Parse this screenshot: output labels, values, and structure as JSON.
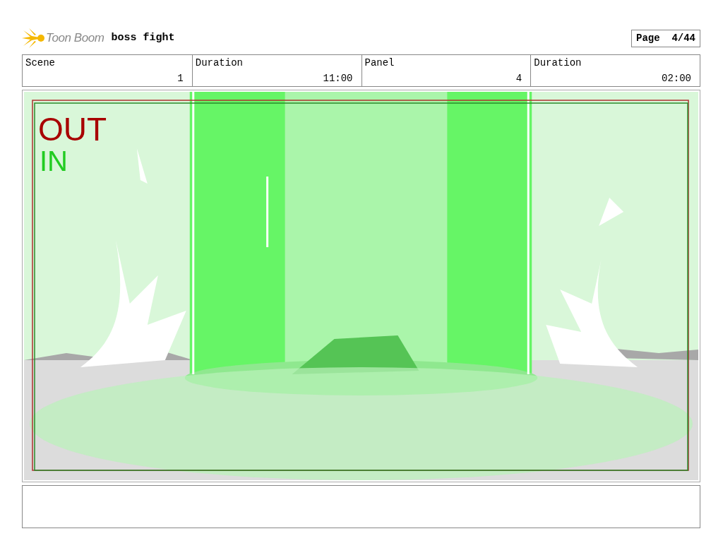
{
  "header": {
    "logo_text": "Toon Boom",
    "title": "boss fight",
    "page": "Page  4/44"
  },
  "info": [
    {
      "label": "Scene",
      "value": "1"
    },
    {
      "label": "Duration",
      "value": "11:00"
    },
    {
      "label": "Panel",
      "value": "4"
    },
    {
      "label": "Duration",
      "value": "02:00"
    }
  ],
  "panel": {
    "in_label": "IN",
    "out_label": "OUT"
  }
}
